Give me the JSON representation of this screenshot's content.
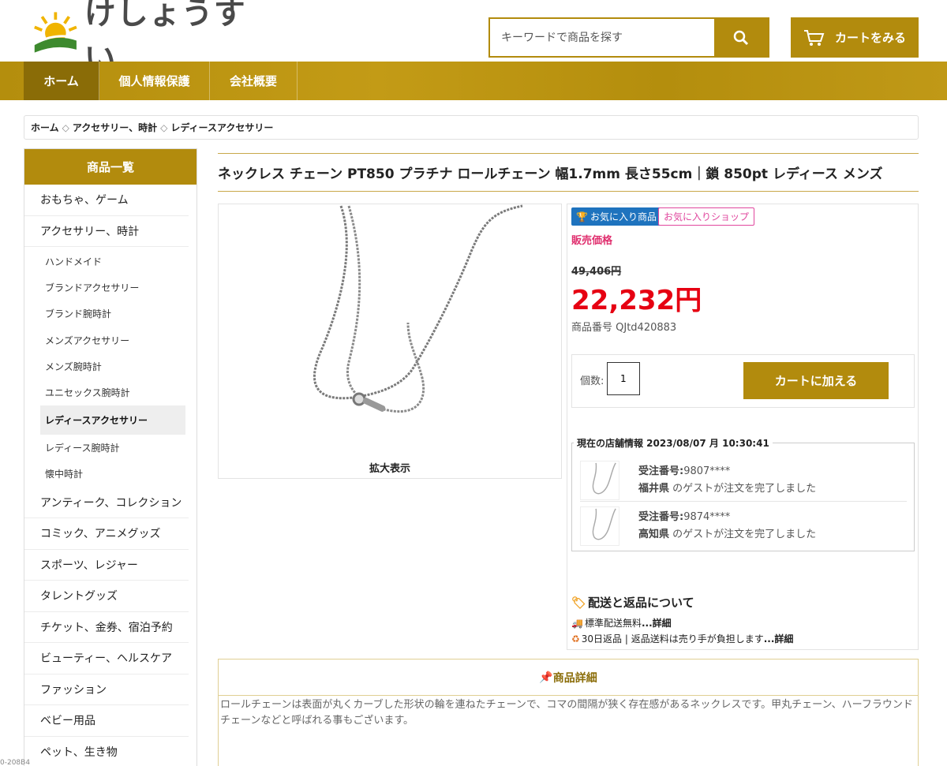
{
  "header": {
    "logo_text": "けしょうすい",
    "search_placeholder": "キーワードで商品を探す",
    "cart_label": "カートをみる",
    "colors": {
      "accent": "#b28b0d",
      "price": "#e60012"
    }
  },
  "nav": {
    "items": [
      {
        "label": "ホーム"
      },
      {
        "label": "個人情報保護"
      },
      {
        "label": "会社概要"
      }
    ]
  },
  "breadcrumb": {
    "items": [
      "ホーム",
      "アクセサリー、時計",
      "レディースアクセサリー"
    ],
    "separator": "◇"
  },
  "sidebar": {
    "title": "商品一覧",
    "top_items": [
      "おもちゃ、ゲーム",
      "アクセサリー、時計"
    ],
    "sub_items": [
      "ハンドメイド",
      "ブランドアクセサリー",
      "ブランド腕時計",
      "メンズアクセサリー",
      "メンズ腕時計",
      "ユニセックス腕時計",
      "レディースアクセサリー",
      "レディース腕時計",
      "懐中時計"
    ],
    "bottom_items": [
      "アンティーク、コレクション",
      "コミック、アニメグッズ",
      "スポーツ、レジャー",
      "タレントグッズ",
      "チケット、金券、宿泊予約",
      "ビューティー、ヘルスケア",
      "ファッション",
      "ベビー用品",
      "ペット、生き物"
    ]
  },
  "product": {
    "title": "ネックレス チェーン PT850 プラチナ ロールチェーン 幅1.7mm 長さ55cm｜鎖 850pt レディース メンズ",
    "zoom_label": "拡大表示",
    "fav_label": "お気に入り商品",
    "fav_shop_label": "お気に入りショップ",
    "price_label": "販売価格",
    "old_price": "49,406円",
    "price": "22,232円",
    "sku": "商品番号 QJtd420883",
    "qty_label": "個数:",
    "qty_value": "1",
    "add_to_cart": "カートに加える"
  },
  "store": {
    "title": "現在の店舗情報 2023/08/07 月 10:30:41",
    "orders": [
      {
        "label": "受注番号:",
        "number": "9807****",
        "pref": "福井県",
        "message": " のゲストが注文を完了しました"
      },
      {
        "label": "受注番号:",
        "number": "9874****",
        "pref": "高知県",
        "message": " のゲストが注文を完了しました"
      }
    ]
  },
  "shipping": {
    "title": "配送と返品について",
    "line1": "標準配送無料",
    "line1_link": "...詳細",
    "line2": "30日返品 | 返品送料は売り手が負担します",
    "line2_link": "...詳細"
  },
  "detail": {
    "title": "商品詳細",
    "text": "ロールチェーンは表面が丸くカーブした形状の輪を連ねたチェーンで、コマの間隔が狭く存在感があるネックレスです。甲丸チェーン、ハーフラウンドチェーンなどと呼ばれる事もございます。"
  },
  "corner_text": "0-208B4"
}
